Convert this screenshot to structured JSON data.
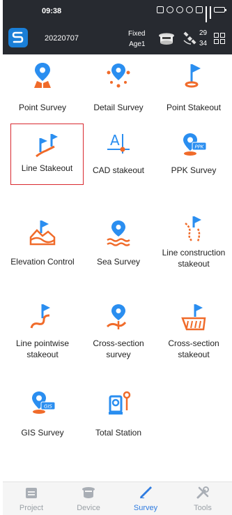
{
  "status_bar": {
    "time": "09:38"
  },
  "header": {
    "project_name": "20220707",
    "solution_status": "Fixed",
    "age_label": "Age1",
    "satellites_used": "29",
    "satellites_tracked": "34"
  },
  "menu": {
    "items": [
      {
        "label": "Point Survey"
      },
      {
        "label": "Detail Survey"
      },
      {
        "label": "Point Stakeout"
      },
      {
        "label": "Line Stakeout"
      },
      {
        "label": "CAD stakeout"
      },
      {
        "label": "PPK Survey"
      },
      {
        "label": "Elevation Control"
      },
      {
        "label": "Sea Survey"
      },
      {
        "label": "Line construction",
        "label2": "stakeout"
      },
      {
        "label": "Line pointwise",
        "label2": "stakeout"
      },
      {
        "label": "Cross-section",
        "label2": "survey"
      },
      {
        "label": "Cross-section",
        "label2": "stakeout"
      },
      {
        "label": "GIS Survey"
      },
      {
        "label": "Total Station"
      }
    ],
    "ppk_badge": "PPK",
    "gis_badge": "GIS"
  },
  "bottom_nav": {
    "items": [
      {
        "label": "Project"
      },
      {
        "label": "Device"
      },
      {
        "label": "Survey"
      },
      {
        "label": "Tools"
      }
    ],
    "active_index": 2
  },
  "colors": {
    "header_bg": "#272a30",
    "icon_blue": "#2a8ef0",
    "icon_orange": "#f06b2a",
    "selection_outline": "#d9282f",
    "nav_active": "#2e7be0"
  }
}
